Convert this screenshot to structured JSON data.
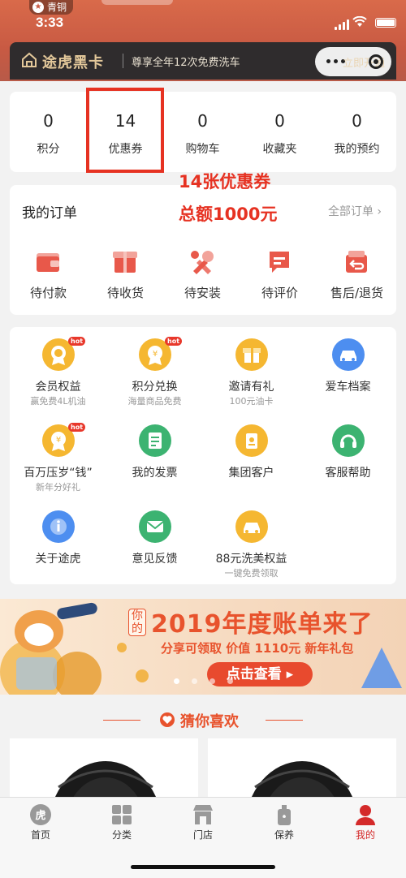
{
  "status_bar": {
    "time": "3:33",
    "back_app": "青铜"
  },
  "vip_bar": {
    "title": "途虎黑卡",
    "desc": "尊享全年12次免费洗车",
    "cta": "立即开通"
  },
  "stats": [
    {
      "num": "0",
      "label": "积分"
    },
    {
      "num": "14",
      "label": "优惠券"
    },
    {
      "num": "0",
      "label": "购物车"
    },
    {
      "num": "0",
      "label": "收藏夹"
    },
    {
      "num": "0",
      "label": "我的预约"
    }
  ],
  "annotation": {
    "line1": "14张优惠券",
    "line2": "总额1000元",
    "color": "#e63222"
  },
  "orders": {
    "title": "我的订单",
    "all_label": "全部订单",
    "items": [
      {
        "label": "待付款",
        "icon": "wallet-icon"
      },
      {
        "label": "待收货",
        "icon": "package-icon"
      },
      {
        "label": "待安装",
        "icon": "wrench-icon"
      },
      {
        "label": "待评价",
        "icon": "comment-icon"
      },
      {
        "label": "售后/退货",
        "icon": "return-icon"
      }
    ]
  },
  "services": [
    {
      "label": "会员权益",
      "sub": "赢免费4L机油",
      "hot": "hot",
      "icon": "medal-icon"
    },
    {
      "label": "积分兑换",
      "sub": "海量商品免费",
      "hot": "hot",
      "icon": "coin-icon"
    },
    {
      "label": "邀请有礼",
      "sub": "100元油卡",
      "hot": "",
      "icon": "gift-icon"
    },
    {
      "label": "爱车档案",
      "sub": "",
      "hot": "",
      "icon": "car-icon"
    },
    {
      "label": "百万压岁“钱”",
      "sub": "新年分好礼",
      "hot": "hot",
      "icon": "money-icon"
    },
    {
      "label": "我的发票",
      "sub": "",
      "hot": "",
      "icon": "invoice-icon"
    },
    {
      "label": "集团客户",
      "sub": "",
      "hot": "",
      "icon": "badge-icon"
    },
    {
      "label": "客服帮助",
      "sub": "",
      "hot": "",
      "icon": "headset-icon"
    },
    {
      "label": "关于途虎",
      "sub": "",
      "hot": "",
      "icon": "info-icon"
    },
    {
      "label": "意见反馈",
      "sub": "",
      "hot": "",
      "icon": "mail-icon"
    },
    {
      "label": "88元洗美权益",
      "sub": "一键免费领取",
      "hot": "",
      "icon": "car-wash-icon"
    }
  ],
  "banner": {
    "prefix": "你的",
    "headline": "2019年度账单来了",
    "sub": "分享可领取 价值 1110元 新年礼包",
    "button": "点击查看 ▸"
  },
  "guess": {
    "title": "猜你喜欢"
  },
  "tabbar": [
    {
      "label": "首页",
      "icon": "tiger-home-icon",
      "active": false
    },
    {
      "label": "分类",
      "icon": "grid-icon",
      "active": false
    },
    {
      "label": "门店",
      "icon": "store-icon",
      "active": false
    },
    {
      "label": "保养",
      "icon": "oil-bottle-icon",
      "active": false
    },
    {
      "label": "我的",
      "icon": "user-icon",
      "active": true
    }
  ],
  "colors": {
    "accent": "#e8532d",
    "vip_gold": "#e3c89a",
    "active_tab": "#d42a2a"
  }
}
